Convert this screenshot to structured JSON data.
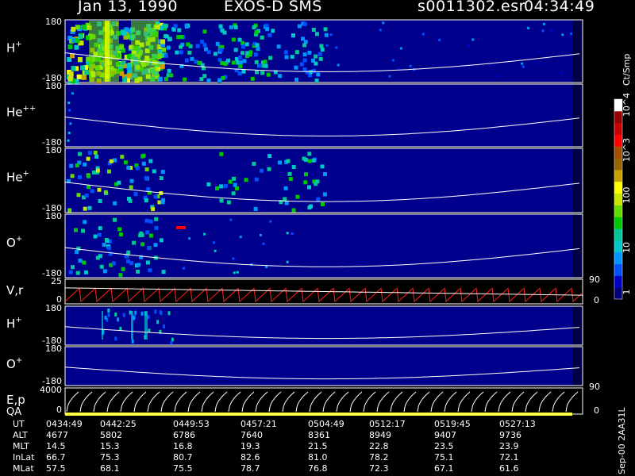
{
  "header": {
    "date": "Jan 13, 1990",
    "instrument": "EXOS-D SMS",
    "file": "s0011302.esr",
    "time": "04:34:49"
  },
  "colorbar": {
    "unit": "Ct/Smp",
    "tick_labels": [
      "1",
      "10",
      "100",
      "10^3",
      "10^4"
    ],
    "colors": [
      "#000078",
      "#0000c8",
      "#0050ff",
      "#0096ff",
      "#00c8c8",
      "#00c896",
      "#00c800",
      "#64dc00",
      "#c8e600",
      "#ffff00",
      "#c8a000",
      "#966400",
      "#a05000",
      "#ff0000",
      "#c80000",
      "#960000",
      "#ffffff"
    ]
  },
  "footer_label": "Sep-00  2AA31L",
  "chart_data": {
    "type": "heatmap",
    "x_ticks": [
      "0434:49",
      "0442:25",
      "0449:53",
      "0457:21",
      "0504:49",
      "0512:17",
      "0519:45",
      "0527:13"
    ],
    "panels": [
      {
        "label": "H",
        "sup": "+",
        "ytop": "180",
        "ybot": "-180"
      },
      {
        "label": "He",
        "sup": "++",
        "ytop": "180",
        "ybot": "-180"
      },
      {
        "label": "He",
        "sup": "+",
        "ytop": "180",
        "ybot": "-180"
      },
      {
        "label": "O",
        "sup": "+",
        "ytop": "180",
        "ybot": "-180"
      },
      {
        "label": "V,r",
        "sup": "",
        "ytop": "25",
        "ybot": "0",
        "rtop": "90",
        "rbot": "0"
      },
      {
        "label": "H",
        "sup": "+",
        "ytop": "180",
        "ybot": "-180"
      },
      {
        "label": "O",
        "sup": "+",
        "ytop": "180",
        "ybot": "-180"
      },
      {
        "label": "E,p",
        "sup": "",
        "label2": "QA",
        "ytop": "4000",
        "ybot": "0",
        "rtop": "90",
        "rbot": "0"
      }
    ],
    "table": {
      "rows": [
        {
          "name": "UT",
          "values": [
            "0434:49",
            "0442:25",
            "0449:53",
            "0457:21",
            "0504:49",
            "0512:17",
            "0519:45",
            "0527:13"
          ]
        },
        {
          "name": "ALT",
          "values": [
            "4677",
            "5802",
            "6786",
            "7640",
            "8361",
            "8949",
            "9407",
            "9736"
          ]
        },
        {
          "name": "MLT",
          "values": [
            "14.5",
            "15.3",
            "16.8",
            "19.3",
            "21.5",
            "22.8",
            "23.5",
            "23.9"
          ]
        },
        {
          "name": "InLat",
          "values": [
            "66.7",
            "75.3",
            "80.7",
            "82.6",
            "81.0",
            "78.2",
            "75.1",
            "72.1"
          ]
        },
        {
          "name": "MLat",
          "values": [
            "57.5",
            "68.1",
            "75.5",
            "78.7",
            "76.8",
            "72.3",
            "67.1",
            "61.6"
          ]
        }
      ]
    }
  }
}
